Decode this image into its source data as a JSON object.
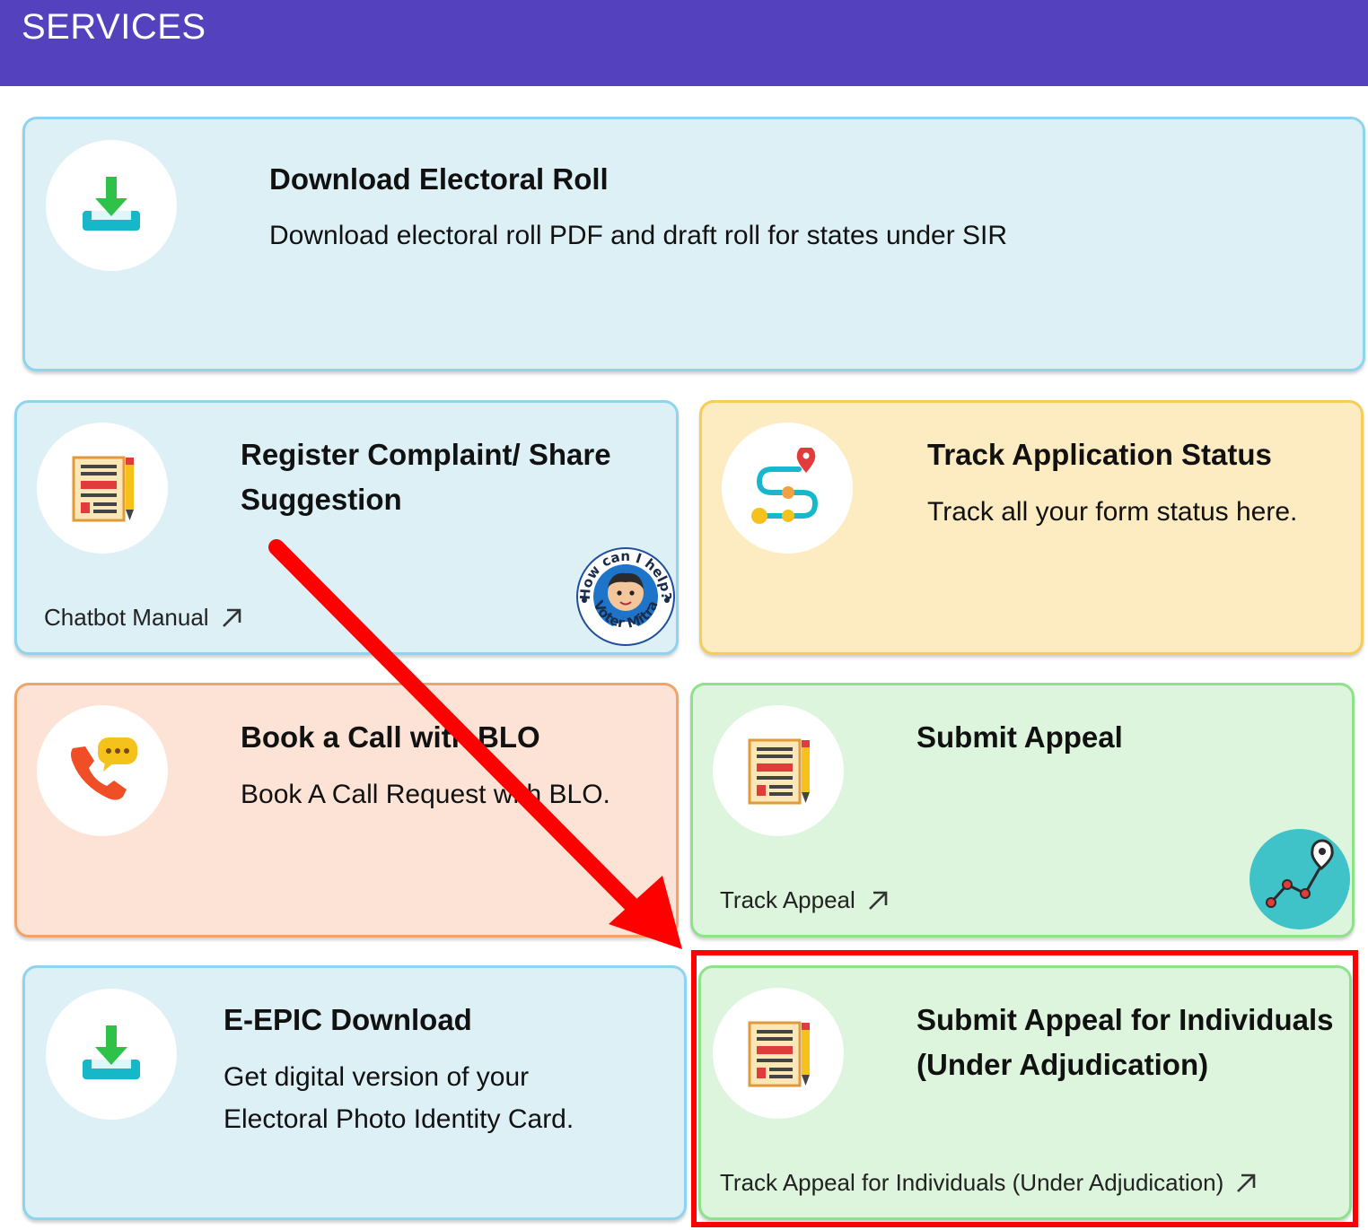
{
  "header": {
    "title": "SERVICES"
  },
  "cards": {
    "download_roll": {
      "title": "Download Electoral Roll",
      "description": "Download electoral roll PDF and draft roll for states under SIR",
      "icon": "download-tray-icon"
    },
    "complaint": {
      "title": "Register Complaint/ Share Suggestion",
      "link": "Chatbot Manual",
      "icon": "form-pencil-icon",
      "badge": {
        "top_text": "How can I help?",
        "bottom_text": "Voter Mitra",
        "icon": "chatbot-avatar-icon"
      }
    },
    "track_status": {
      "title": "Track Application Status",
      "description": "Track all your form status here.",
      "icon": "route-tracking-icon"
    },
    "book_call": {
      "title": "Book a Call with BLO",
      "description": "Book A Call Request with BLO.",
      "icon": "phone-chat-icon"
    },
    "submit_appeal": {
      "title": "Submit Appeal",
      "link": "Track Appeal",
      "icon": "form-pencil-icon",
      "badge_icon": "track-path-icon"
    },
    "epic": {
      "title": "E-EPIC Download",
      "description_lines": [
        "Get digital version of your",
        "Electoral Photo Identity Card."
      ],
      "icon": "download-tray-icon"
    },
    "appeal_individuals": {
      "title_lines": [
        "Submit Appeal for Individuals",
        "(Under Adjudication)"
      ],
      "link": "Track Appeal for Individuals (Under Adjudication)",
      "icon": "form-pencil-icon"
    }
  },
  "colors": {
    "header": "#5341bd",
    "blue_card": "#dcf0f6",
    "yellow_card": "#fdebc1",
    "peach_card": "#fde3d5",
    "green_card": "#dcf5dc",
    "highlight": "#ff0000"
  }
}
